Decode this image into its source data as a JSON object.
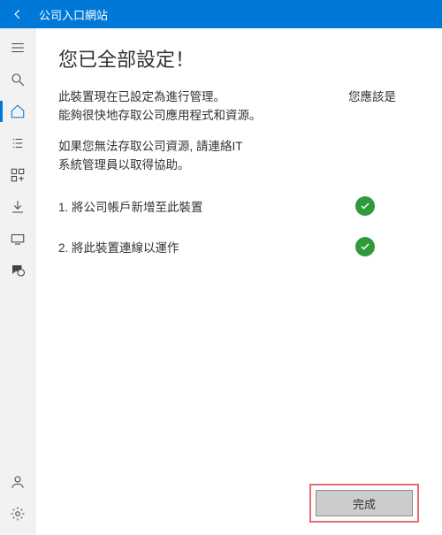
{
  "titlebar": {
    "title": "公司入口網站"
  },
  "sidebar": {
    "items": [
      {
        "name": "menu"
      },
      {
        "name": "search"
      },
      {
        "name": "home"
      },
      {
        "name": "list"
      },
      {
        "name": "apps"
      },
      {
        "name": "download"
      },
      {
        "name": "devices"
      },
      {
        "name": "chat"
      }
    ],
    "bottom": [
      {
        "name": "account"
      },
      {
        "name": "settings"
      }
    ]
  },
  "main": {
    "heading": "您已全部設定！",
    "p1_left_line1": "此裝置現在已設定為進行管理。",
    "p1_right": "您應該是",
    "p1_left_line2": "能夠很快地存取公司應用程式和資源。",
    "p2_line1": "如果您無法存取公司資源, 請連絡",
    "p2_it": "IT",
    "p2_line2": "系統管理員以取得協助。",
    "steps": [
      {
        "label": "1. 將公司帳戶新增至此裝置",
        "done": true
      },
      {
        "label": "2. 將此裝置連線以運作",
        "done": true
      }
    ],
    "done_button": "完成"
  }
}
